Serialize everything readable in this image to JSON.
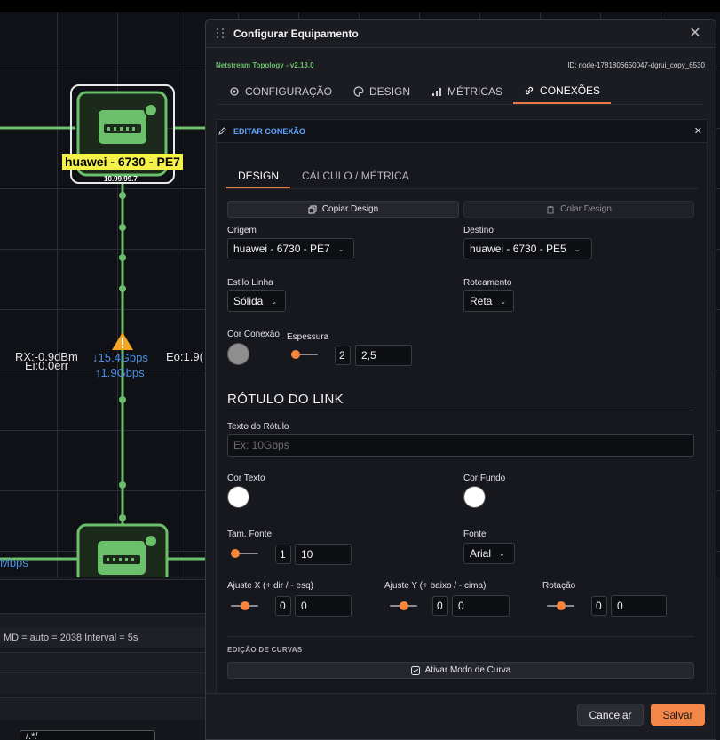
{
  "colors": {
    "accent": "#f3874a",
    "link": "#6cc06c",
    "label_bg": "#f4f14a",
    "edit_header": "#5aa6ff",
    "warning": "#f5a623"
  },
  "topology": {
    "node_top": {
      "label": "huawei - 6730 - PE7",
      "ip": "10.99.99.7",
      "icon": "router-icon"
    },
    "node_bottom": {
      "icon": "router-icon"
    },
    "link_texts": {
      "rx": "RX:-0.9dBm",
      "ei": "Ei:0.0err",
      "down": "↓15.4Gbps",
      "up": "↑1.9Gbps",
      "eo": "Eo:1.9(",
      "bottom_left": "Mbps"
    },
    "warning_icon": "warning-triangle-icon"
  },
  "bottom_panel": {
    "status": "MD = auto = 2038    Interval = 5s",
    "select_value": "/.*/"
  },
  "modal": {
    "title": "Configurar Equipamento",
    "version": "Netstream Topology - v2.13.0",
    "node_id": "ID: node-1781806650047-dgrui_copy_6530",
    "tabs": [
      {
        "label": "CONFIGURAÇÃO",
        "icon": "gear-icon"
      },
      {
        "label": "DESIGN",
        "icon": "palette-icon"
      },
      {
        "label": "MÉTRICAS",
        "icon": "bar-chart-icon"
      },
      {
        "label": "CONEXÕES",
        "icon": "link-icon",
        "active": true
      }
    ],
    "edit": {
      "header": "EDITAR CONEXÃO",
      "sub_tabs": [
        {
          "label": "DESIGN",
          "active": true
        },
        {
          "label": "CÁLCULO / MÉTRICA"
        }
      ],
      "copy_design": "Copiar Design",
      "paste_design": "Colar Design",
      "origin_label": "Origem",
      "origin_value": "huawei - 6730 - PE7",
      "dest_label": "Destino",
      "dest_value": "huawei - 6730 - PE5",
      "line_style_label": "Estilo Linha",
      "line_style_value": "Sólida",
      "routing_label": "Roteamento",
      "routing_value": "Reta",
      "conn_color_label": "Cor Conexão",
      "conn_color": "#8e8e8e",
      "thickness_label": "Espessura",
      "thickness_mini": "2",
      "thickness_value": "2,5",
      "thickness_level": 0.15,
      "link_label_title": "RÓTULO DO LINK",
      "label_text_label": "Texto do Rótulo",
      "label_text_placeholder": "Ex: 10Gbps",
      "text_color_label": "Cor Texto",
      "text_color": "#ffffff",
      "bg_color_label": "Cor Fundo",
      "bg_color": "#ffffff",
      "font_size_label": "Tam. Fonte",
      "font_size_mini": "1",
      "font_size_value": "10",
      "font_size_level": 0.1,
      "font_label": "Fonte",
      "font_value": "Arial",
      "adjust_x_label": "Ajuste X (+ dir / - esq)",
      "adjust_x_mini": "0",
      "adjust_x_value": "0",
      "adjust_y_label": "Ajuste Y (+ baixo / - cima)",
      "adjust_y_mini": "0",
      "adjust_y_value": "0",
      "rotation_label": "Rotação",
      "rotation_mini": "0",
      "rotation_value": "0",
      "slider_mid_level": 0.5,
      "curves_title": "EDIÇÃO DE CURVAS",
      "curve_mode_button": "Ativar Modo de Curva"
    },
    "cancel": "Cancelar",
    "save": "Salvar"
  }
}
